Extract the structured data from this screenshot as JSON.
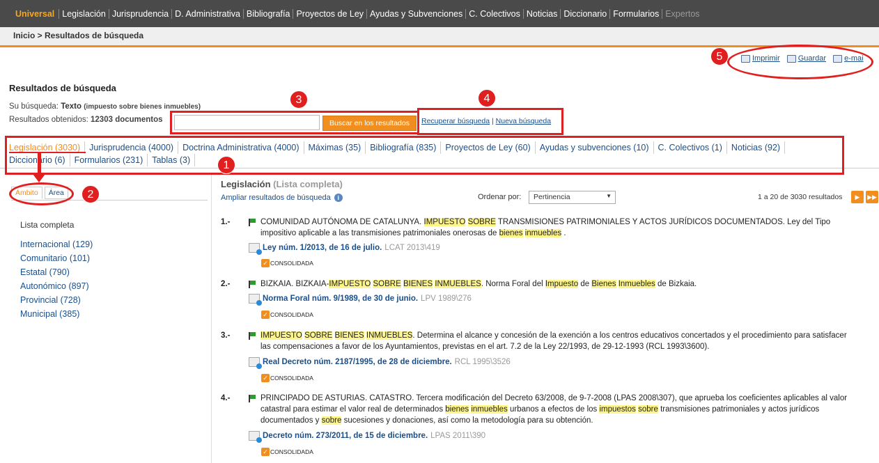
{
  "topnav": [
    "Universal",
    "Legislación",
    "Jurisprudencia",
    "D. Administrativa",
    "Bibliografía",
    "Proyectos de Ley",
    "Ayudas y Subvenciones",
    "C. Colectivos",
    "Noticias",
    "Diccionario",
    "Formularios",
    "Expertos"
  ],
  "breadcrumb": "Inicio > Resultados de búsqueda",
  "tools": {
    "print": "Imprimir",
    "save": "Guardar",
    "email": "e-mai"
  },
  "heading": "Resultados de búsqueda",
  "query": {
    "label": "Su búsqueda:",
    "type": "Texto",
    "terms": "(impuesto sobre bienes inmuebles)"
  },
  "count": {
    "label": "Resultados obtenidos:",
    "value": "12303 documentos"
  },
  "search_button": "Buscar en los resultados",
  "recover": "Recuperar búsqueda",
  "new_search": "Nueva búsqueda",
  "category_tabs": [
    "Legislación (3030)",
    "Jurisprudencia (4000)",
    "Doctrina Administrativa (4000)",
    "Máximas (35)",
    "Bibliografía (835)",
    "Proyectos de Ley (60)",
    "Ayudas y subvenciones (10)",
    "C. Colectivos (1)",
    "Noticias (92)",
    "Diccionario (6)",
    "Formularios (231)",
    "Tablas (3)"
  ],
  "side_tabs": [
    "Ámbito",
    "Área"
  ],
  "side": {
    "header": "Lista completa",
    "items": [
      "Internacional (129)",
      "Comunitario (101)",
      "Estatal (790)",
      "Autonómico (897)",
      "Provincial (728)",
      "Municipal (385)"
    ]
  },
  "results_title": "Legislación",
  "results_subtitle": "(Lista completa)",
  "expand": "Ampliar resultados de búsqueda",
  "order_label": "Ordenar por:",
  "order_value": "Pertinencia",
  "pagination": "1 a 20 de 3030 resultados",
  "consolidated": "CONSOLIDADA",
  "annotations": [
    "1",
    "2",
    "3",
    "4",
    "5"
  ],
  "results": [
    {
      "num": "1.-",
      "ref": "Ley núm. 1/2013, de 16 de julio.",
      "ref_code": "LCAT 2013\\419"
    },
    {
      "num": "2.-",
      "ref": "Norma Foral núm. 9/1989, de 30 de junio.",
      "ref_code": "LPV 1989\\276"
    },
    {
      "num": "3.-",
      "ref": "Real Decreto núm. 2187/1995, de 28 de diciembre.",
      "ref_code": "RCL 1995\\3526"
    },
    {
      "num": "4.-",
      "ref": "Decreto núm. 273/2011, de 15 de diciembre.",
      "ref_code": "LPAS 2011\\390"
    }
  ],
  "colors": {
    "accent": "#f28c1e",
    "link": "#1a4f8b",
    "nav_bg": "#4a4a4a",
    "annotation": "#e02020",
    "highlight": "#fdf48a"
  }
}
